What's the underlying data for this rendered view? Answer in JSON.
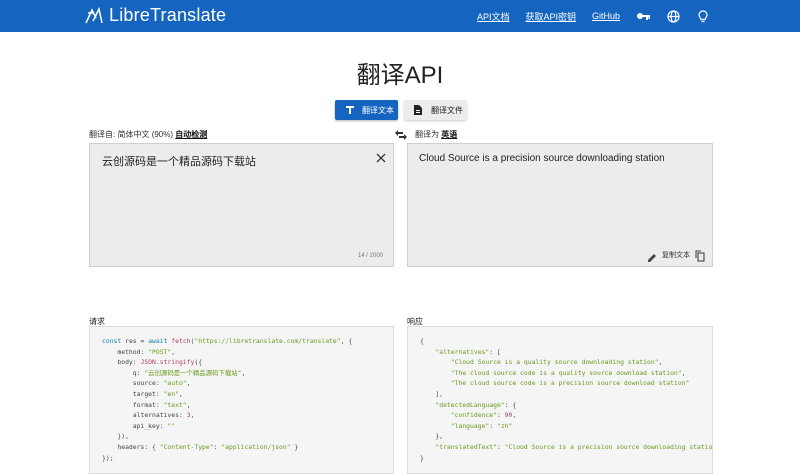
{
  "header": {
    "brand": "LibreTranslate",
    "links": [
      "API文档",
      "获取API密钥",
      "GitHub"
    ],
    "icons": [
      "key-icon",
      "globe-icon",
      "lightbulb-icon"
    ]
  },
  "title": "翻译API",
  "mode_tabs": {
    "text_label": "翻译文本",
    "file_label": "翻译文件"
  },
  "source": {
    "label_prefix": "翻译自:",
    "detected": "简体中文 (90%)",
    "selected": "自动检测",
    "text": "云创源码是一个精品源码下载站",
    "char_count": "14 / 2000"
  },
  "target": {
    "label_prefix": "翻译为",
    "selected": "英语",
    "text": "Cloud Source is a precision source downloading station",
    "copy_label": "复制文本"
  },
  "request": {
    "label": "请求",
    "url": "\"https://libretranslate.com/translate\"",
    "method": "\"POST\"",
    "q": "\"云创源码是一个精品源码下载站\"",
    "source_val": "\"auto\"",
    "target_val": "\"en\"",
    "format_val": "\"text\"",
    "alternatives_val": "3",
    "api_key_val": "\"\"",
    "content_type": "\"application/json\""
  },
  "response": {
    "label": "响应",
    "alternatives": [
      "\"Cloud Source is a quality source downloading station\"",
      "\"The cloud source code is a quality source download station\"",
      "\"The cloud source code is a precision source download station\""
    ],
    "confidence": "90",
    "language": "\"zh\"",
    "translated_text": "\"Cloud Source is a precision source downloading station\""
  },
  "colors": {
    "brand_blue": "#1565c0",
    "box_bg": "#ececec",
    "code_bg": "#f5f5f5"
  }
}
